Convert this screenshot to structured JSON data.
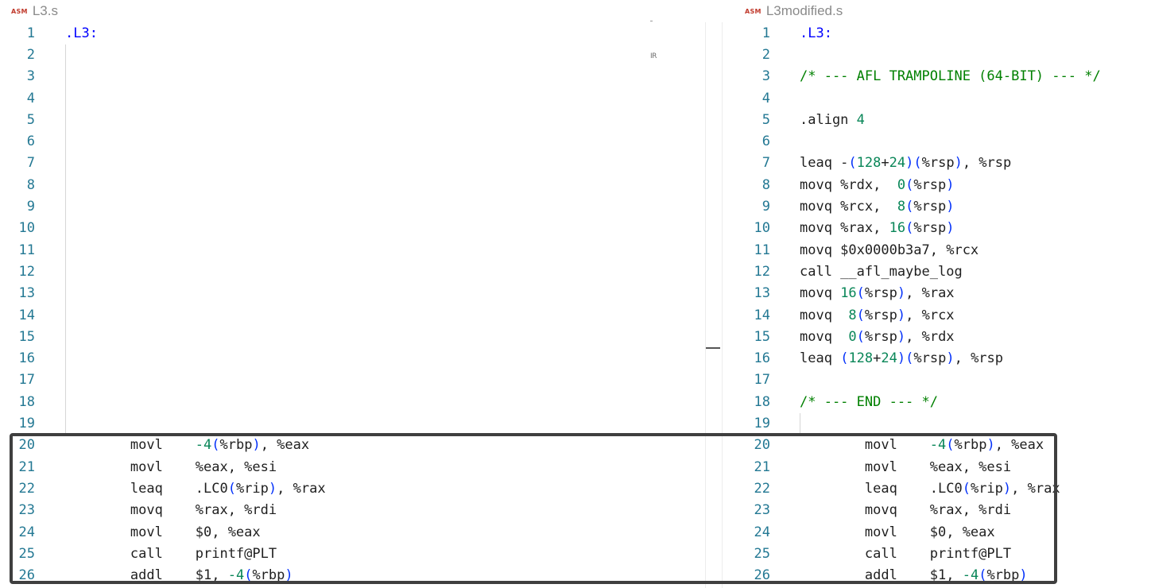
{
  "tabs": {
    "left": {
      "badge": "ASM",
      "name": "L3.s"
    },
    "right": {
      "badge": "ASM",
      "name": "L3modified.s"
    }
  },
  "icons": {
    "file_type": "asm-file-icon",
    "minimap_marker": "minimap-marker-icon"
  },
  "minimap_text": "IR",
  "colors": {
    "line_number": "#237893",
    "label": "#0000ff",
    "comment": "#008000",
    "number": "#098658",
    "paren": "#0431fa",
    "highlight_border": "#3f3f3f"
  },
  "left_editor": {
    "line_numbers": [
      "1",
      "2",
      "3",
      "4",
      "5",
      "6",
      "7",
      "8",
      "9",
      "10",
      "11",
      "12",
      "13",
      "14",
      "15",
      "16",
      "17",
      "18",
      "19",
      "20",
      "21",
      "22",
      "23",
      "24",
      "25",
      "26"
    ],
    "lines": {
      "1": ".L3:",
      "20": "        movl    -4(%rbp), %eax",
      "21": "        movl    %eax, %esi",
      "22": "        leaq    .LC0(%rip), %rax",
      "23": "        movq    %rax, %rdi",
      "24": "        movl    $0, %eax",
      "25": "        call    printf@PLT",
      "26": "        addl    $1, -4(%rbp)"
    }
  },
  "right_editor": {
    "line_numbers": [
      "1",
      "2",
      "3",
      "4",
      "5",
      "6",
      "7",
      "8",
      "9",
      "10",
      "11",
      "12",
      "13",
      "14",
      "15",
      "16",
      "17",
      "18",
      "19",
      "20",
      "21",
      "22",
      "23",
      "24",
      "25",
      "26"
    ],
    "lines": {
      "1": ".L3:",
      "3": "/* --- AFL TRAMPOLINE (64-BIT) --- */",
      "5": ".align 4",
      "7": "leaq -(128+24)(%rsp), %rsp",
      "8": "movq %rdx,  0(%rsp)",
      "9": "movq %rcx,  8(%rsp)",
      "10": "movq %rax, 16(%rsp)",
      "11": "movq $0x0000b3a7, %rcx",
      "12": "call __afl_maybe_log",
      "13": "movq 16(%rsp), %rax",
      "14": "movq  8(%rsp), %rcx",
      "15": "movq  0(%rsp), %rdx",
      "16": "leaq (128+24)(%rsp), %rsp",
      "18": "/* --- END --- */",
      "20": "        movl    -4(%rbp), %eax",
      "21": "        movl    %eax, %esi",
      "22": "        leaq    .LC0(%rip), %rax",
      "23": "        movq    %rax, %rdi",
      "24": "        movl    $0, %eax",
      "25": "        call    printf@PLT",
      "26": "        addl    $1, -4(%rbp)"
    }
  }
}
